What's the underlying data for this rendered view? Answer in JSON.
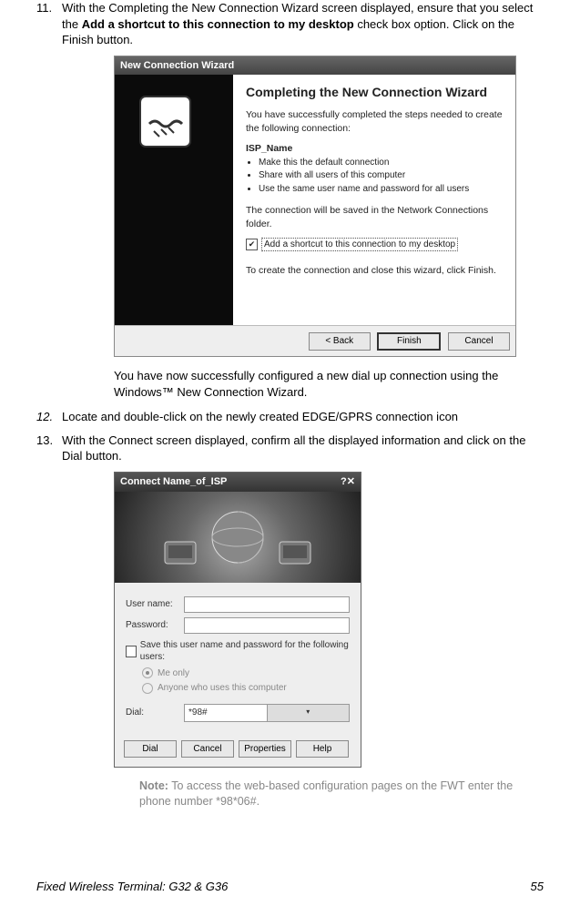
{
  "steps": {
    "s11": {
      "num": "11.",
      "text_a": "With the Completing the New Connection Wizard screen displayed, ensure that you select the ",
      "bold": "Add a shortcut to this connection to my desktop",
      "text_b": " check box option. Click on the Finish button."
    },
    "s12": {
      "num": "12.",
      "text": "Locate and double-click on the newly created EDGE/GPRS connection icon",
      "italic_num": true
    },
    "s13": {
      "num": "13.",
      "text": "With the Connect screen displayed, confirm all the displayed information and click on the Dial button."
    }
  },
  "intro_after_wizard": "You have now successfully configured a new dial up connection using the Windows™ New Connection Wizard.",
  "wizard": {
    "title": "New Connection Wizard",
    "heading": "Completing the New Connection Wizard",
    "line1": "You have successfully completed the steps needed to create the following connection:",
    "isp": "ISP_Name",
    "bullets": [
      "Make this the default connection",
      "Share with all users of this computer",
      "Use the same user name and password for all users"
    ],
    "line2": "The connection will be saved in the Network Connections folder.",
    "checkbox_label": "Add a shortcut to this connection to my desktop",
    "line3": "To create the connection and close this wizard, click Finish.",
    "buttons": {
      "back": "< Back",
      "finish": "Finish",
      "cancel": "Cancel"
    }
  },
  "connect": {
    "title": "Connect Name_of_ISP",
    "username_label": "User name:",
    "username_value": "",
    "password_label": "Password:",
    "password_value": "",
    "save_label": "Save this user name and password for the following users:",
    "radio1": "Me only",
    "radio2": "Anyone who uses this computer",
    "dial_label": "Dial:",
    "dial_value": "*98#",
    "buttons": {
      "dial": "Dial",
      "cancel": "Cancel",
      "properties": "Properties",
      "help": "Help"
    }
  },
  "note": {
    "label": "Note:",
    "text": " To access the web-based configuration pages on the FWT enter the phone number *98*06#."
  },
  "footer": {
    "left": "Fixed Wireless Terminal: G32 & G36",
    "right": "55"
  }
}
